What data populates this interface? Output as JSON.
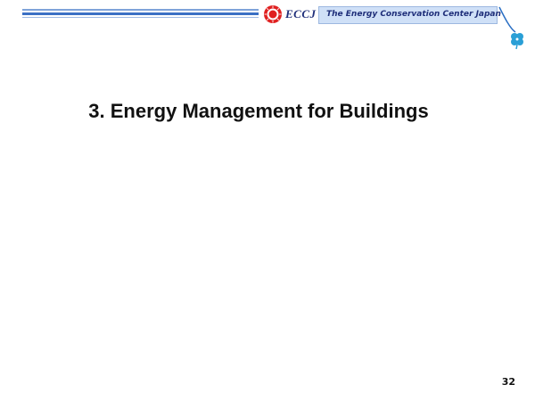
{
  "header": {
    "brand": "ECCJ",
    "organization": "The Energy Conservation Center Japan",
    "logo_icon": "eccj-sun-logo",
    "clover_icon": "clover-icon",
    "accent_color": "#3a6fc4",
    "banner_color": "#cfe0f7",
    "brand_text_color": "#1f2f7a",
    "logo_color": "#e02020",
    "clover_color": "#2a9fd6"
  },
  "slide": {
    "title": "3. Energy Management for Buildings",
    "page_number": "32"
  }
}
